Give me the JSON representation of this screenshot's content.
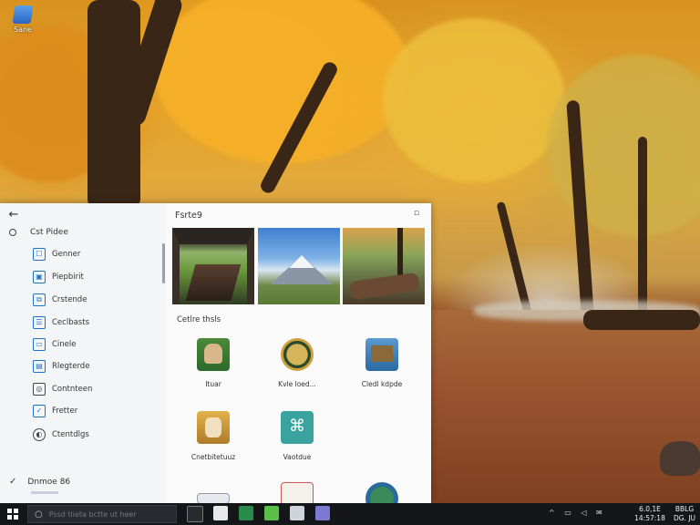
{
  "desktop": {
    "icon_label": "Sane"
  },
  "window": {
    "back_label": "←",
    "home_label": "Cst Pidee",
    "nav_items": [
      {
        "label": "Genner",
        "icon": "app-icon"
      },
      {
        "label": "Piepbirit",
        "icon": "app-icon"
      },
      {
        "label": "Crstende",
        "icon": "app-icon"
      },
      {
        "label": "Ceclbasts",
        "icon": "app-icon"
      },
      {
        "label": "Cinele",
        "icon": "app-icon"
      },
      {
        "label": "Rlegterde",
        "icon": "app-icon"
      },
      {
        "label": "Contnteen",
        "icon": "app-icon"
      },
      {
        "label": "Fretter",
        "icon": "app-icon"
      },
      {
        "label": "Ctentdlgs",
        "icon": "app-icon"
      }
    ],
    "bottom_label": "Dnmoe 86",
    "main_title": "Fsrte9",
    "section_label": "Cetlre thsls",
    "apps": [
      {
        "label": "Ituar"
      },
      {
        "label": "Kvle loed..."
      },
      {
        "label": "Cledl kdpde"
      },
      {
        "label": "Cnetbitetuuz"
      },
      {
        "label": "Vaotdue"
      },
      {
        "label": ""
      },
      {
        "label": ""
      },
      {
        "label": ""
      }
    ]
  },
  "taskbar": {
    "search_placeholder": "Pssd tlieta bctte ut heer",
    "tray_icons": "^ ▭ ◁ ✉",
    "clock_time": "6.0,1E",
    "clock_date": "14:57:18",
    "clock_extra_1": "BBLG",
    "clock_extra_2": "DG. JU"
  }
}
